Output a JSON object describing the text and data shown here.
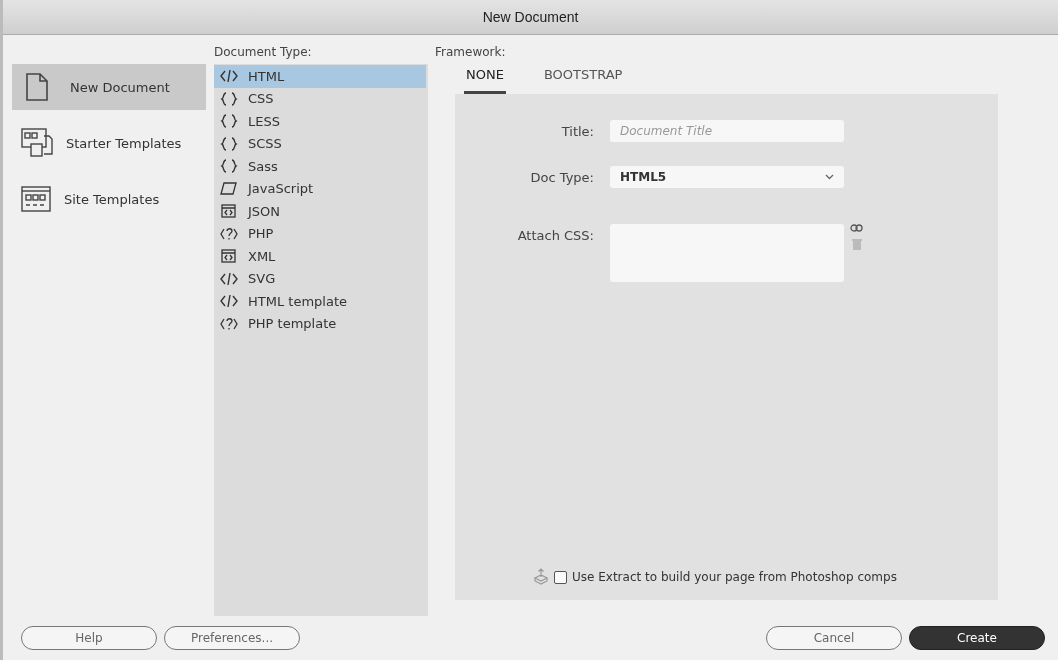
{
  "window": {
    "title": "New Document"
  },
  "sidebar": {
    "items": [
      {
        "label": "New Document",
        "kind": "document",
        "selected": true
      },
      {
        "label": "Starter Templates",
        "kind": "starter",
        "selected": false
      },
      {
        "label": "Site Templates",
        "kind": "site",
        "selected": false
      }
    ]
  },
  "document_type": {
    "label": "Document Type:",
    "items": [
      {
        "label": "HTML",
        "kind": "tag",
        "selected": true
      },
      {
        "label": "CSS",
        "kind": "braces",
        "selected": false
      },
      {
        "label": "LESS",
        "kind": "braces",
        "selected": false
      },
      {
        "label": "SCSS",
        "kind": "braces",
        "selected": false
      },
      {
        "label": "Sass",
        "kind": "braces",
        "selected": false
      },
      {
        "label": "JavaScript",
        "kind": "script",
        "selected": false
      },
      {
        "label": "JSON",
        "kind": "box",
        "selected": false
      },
      {
        "label": "PHP",
        "kind": "php",
        "selected": false
      },
      {
        "label": "XML",
        "kind": "box",
        "selected": false
      },
      {
        "label": "SVG",
        "kind": "tag",
        "selected": false
      },
      {
        "label": "HTML template",
        "kind": "tag",
        "selected": false
      },
      {
        "label": "PHP template",
        "kind": "php",
        "selected": false
      }
    ]
  },
  "framework": {
    "label": "Framework:",
    "tabs": [
      {
        "label": "NONE",
        "selected": true
      },
      {
        "label": "BOOTSTRAP",
        "selected": false
      }
    ],
    "title_field": {
      "label": "Title:",
      "placeholder": "Document Title"
    },
    "doc_type_field": {
      "label": "Doc Type:",
      "value": "HTML5"
    },
    "attach_css": {
      "label": "Attach CSS:"
    },
    "extract_option": {
      "label": "Use Extract to build your page from Photoshop comps",
      "checked": false
    }
  },
  "buttons": [
    {
      "label": "Help",
      "kind": "secondary"
    },
    {
      "label": "Preferences...",
      "kind": "secondary"
    },
    {
      "label": "Cancel",
      "kind": "secondary"
    },
    {
      "label": "Create",
      "kind": "primary"
    }
  ]
}
